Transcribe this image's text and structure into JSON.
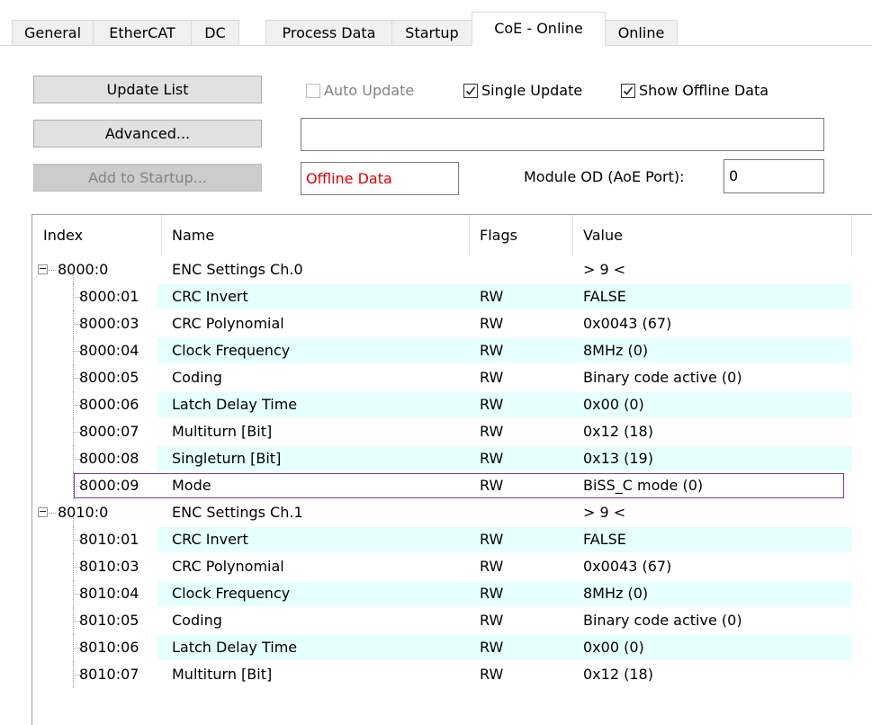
{
  "tabs": [
    {
      "label": "General",
      "active": false
    },
    {
      "label": "EtherCAT",
      "active": false
    },
    {
      "label": "DC",
      "active": false
    },
    {
      "label": "Process Data",
      "active": false
    },
    {
      "label": "Startup",
      "active": false
    },
    {
      "label": "CoE - Online",
      "active": true
    },
    {
      "label": "Online",
      "active": false
    }
  ],
  "toolbar": {
    "update_list": "Update List",
    "advanced": "Advanced...",
    "add_to_startup": "Add to Startup...",
    "auto_update": "Auto Update",
    "auto_update_checked": false,
    "single_update": "Single Update",
    "single_update_checked": true,
    "show_offline": "Show Offline Data",
    "show_offline_checked": true,
    "status_text": "Offline Data",
    "status_color": "#e00000",
    "module_od_label": "Module OD (AoE Port):",
    "module_od_value": "0",
    "path_value": ""
  },
  "table": {
    "headers": {
      "index": "Index",
      "name": "Name",
      "flags": "Flags",
      "value": "Value"
    },
    "rows": [
      {
        "index": "8000:0",
        "name": "ENC Settings Ch.0",
        "flags": "",
        "value": "> 9 <",
        "group": true
      },
      {
        "index": "8000:01",
        "name": "CRC Invert",
        "flags": "RW",
        "value": "FALSE"
      },
      {
        "index": "8000:03",
        "name": "CRC Polynomial",
        "flags": "RW",
        "value": "0x0043 (67)"
      },
      {
        "index": "8000:04",
        "name": "Clock Frequency",
        "flags": "RW",
        "value": "8MHz (0)"
      },
      {
        "index": "8000:05",
        "name": "Coding",
        "flags": "RW",
        "value": "Binary code active (0)"
      },
      {
        "index": "8000:06",
        "name": "Latch Delay Time",
        "flags": "RW",
        "value": "0x00 (0)"
      },
      {
        "index": "8000:07",
        "name": "Multiturn [Bit]",
        "flags": "RW",
        "value": "0x12 (18)"
      },
      {
        "index": "8000:08",
        "name": "Singleturn [Bit]",
        "flags": "RW",
        "value": "0x13 (19)"
      },
      {
        "index": "8000:09",
        "name": "Mode",
        "flags": "RW",
        "value": "BiSS_C mode (0)",
        "selected": true
      },
      {
        "index": "8010:0",
        "name": "ENC Settings Ch.1",
        "flags": "",
        "value": "> 9 <",
        "group": true
      },
      {
        "index": "8010:01",
        "name": "CRC Invert",
        "flags": "RW",
        "value": "FALSE"
      },
      {
        "index": "8010:03",
        "name": "CRC Polynomial",
        "flags": "RW",
        "value": "0x0043 (67)"
      },
      {
        "index": "8010:04",
        "name": "Clock Frequency",
        "flags": "RW",
        "value": "8MHz (0)"
      },
      {
        "index": "8010:05",
        "name": "Coding",
        "flags": "RW",
        "value": "Binary code active (0)"
      },
      {
        "index": "8010:06",
        "name": "Latch Delay Time",
        "flags": "RW",
        "value": "0x00 (0)"
      },
      {
        "index": "8010:07",
        "name": "Multiturn [Bit]",
        "flags": "RW",
        "value": "0x12 (18)"
      }
    ]
  },
  "colors": {
    "row_tint": "#e6ffff",
    "selection_border": "#7c3f8e"
  }
}
